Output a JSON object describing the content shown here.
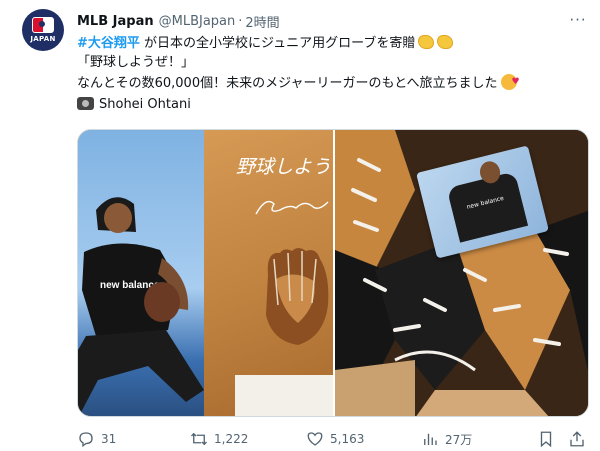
{
  "account": {
    "avatar_label": "JAPAN",
    "name": "MLB Japan",
    "handle": "@MLBJapan",
    "separator": "·",
    "time": "2時間"
  },
  "menu_glyph": "···",
  "tweet": {
    "hashtag": "#大谷翔平",
    "line1_rest": " が日本の全小学校にジュニア用グローブを寄贈",
    "line2": "「野球しようぜ！」",
    "line3": "なんとその数60,000個！未来のメジャーリーガーのもとへ旅立ちました",
    "line4": "Shohei Ohtani"
  },
  "media": {
    "shirt_text": "new balance",
    "signature_text": "野球しよう",
    "card_brand": "new balance"
  },
  "metrics": {
    "replies": "31",
    "reposts": "1,222",
    "likes": "5,163",
    "views": "27万"
  },
  "icons": {
    "reply": "reply-icon",
    "repost": "repost-icon",
    "like": "heart-icon",
    "views": "views-icon",
    "bookmark": "bookmark-icon",
    "share": "share-icon"
  }
}
